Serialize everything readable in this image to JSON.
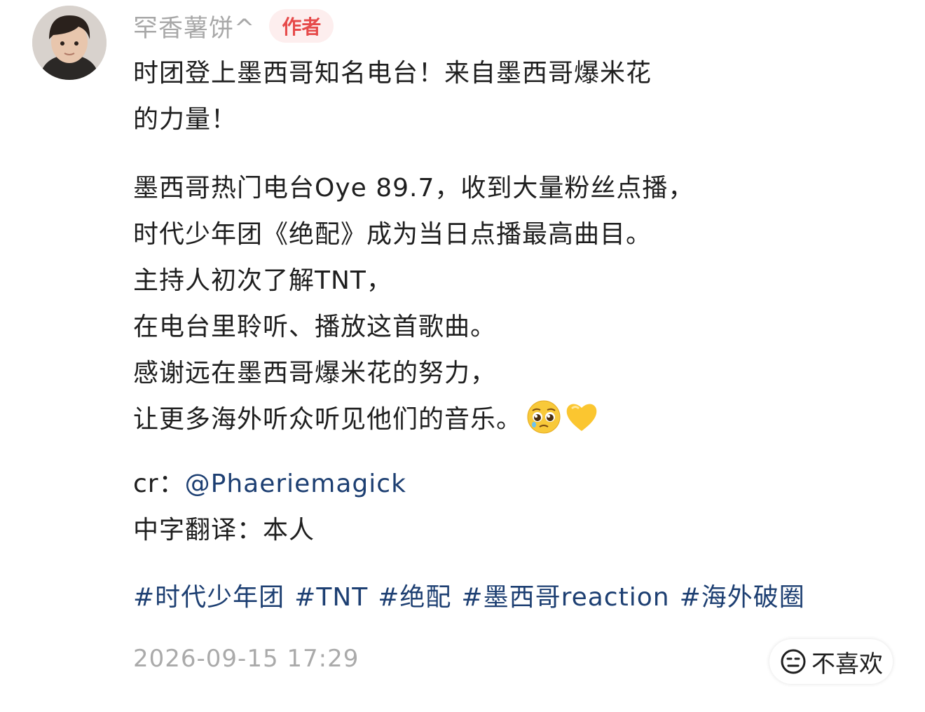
{
  "author": {
    "username": "罕香薯饼^",
    "badge": "作者"
  },
  "post": {
    "paragraph1": [
      "时团登上墨西哥知名电台！来自墨西哥爆米花",
      "的力量！"
    ],
    "paragraph2": [
      "墨西哥热门电台Oye 89.7，收到大量粉丝点播，",
      "时代少年团《绝配》成为当日点播最高曲目。",
      "主持人初次了解TNT，",
      "在电台里聆听、播放这首歌曲。",
      "感谢远在墨西哥爆米花的努力，",
      "让更多海外听众听见他们的音乐。"
    ],
    "emojis": [
      "pleading-face-emoji",
      "yellow-heart-emoji"
    ],
    "credit_prefix": "cr：",
    "credit_mention": "@Phaeriemagick",
    "translation_line": "中字翻译：本人",
    "hashtags": [
      "#时代少年团",
      "#TNT",
      "#绝配",
      "#墨西哥reaction",
      "#海外破圈"
    ]
  },
  "meta": {
    "timestamp": "2026-09-15 17:29",
    "dislike_label": "不喜欢"
  },
  "colors": {
    "link": "#1d3f72",
    "badge_text": "#e64a4a",
    "badge_bg": "#fdeeee",
    "muted": "#aaaaaa"
  },
  "icons": {
    "dislike": "neutral-face-icon"
  }
}
